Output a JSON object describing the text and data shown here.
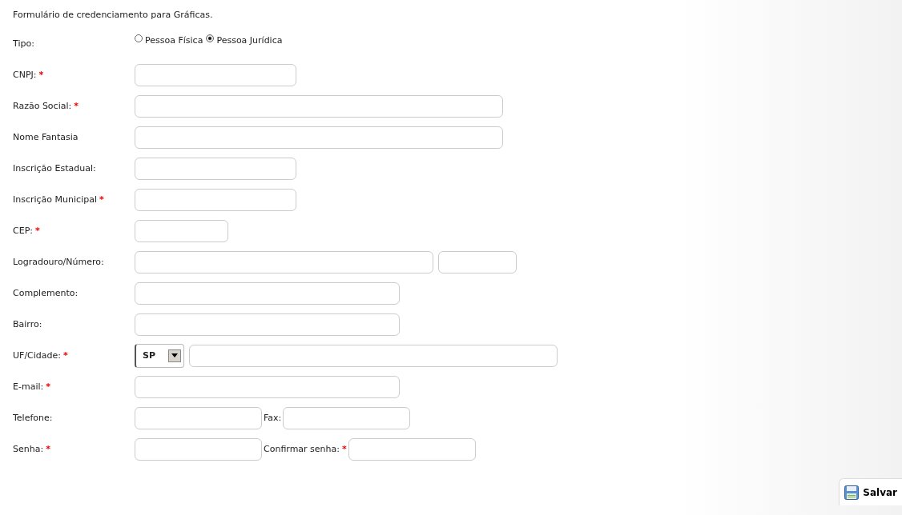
{
  "title": "Formulário de credenciamento para Gráficas.",
  "rows": [
    {
      "label": "Tipo:",
      "kind": "radio",
      "options": [
        {
          "label": "Pessoa Física",
          "selected": false
        },
        {
          "label": "Pessoa Jurídica",
          "selected": true
        }
      ]
    },
    {
      "label": "CNPJ:",
      "required_mark": "*",
      "kind": "fields",
      "fields": [
        {
          "kind": "text"
        }
      ]
    },
    {
      "label": "Razão Social:",
      "required_mark": "*",
      "kind": "fields",
      "fields": [
        {
          "kind": "text"
        }
      ]
    },
    {
      "label": "Nome Fantasia",
      "kind": "fields",
      "fields": [
        {
          "kind": "text"
        }
      ]
    },
    {
      "label": "Inscrição Estadual:",
      "kind": "fields",
      "fields": [
        {
          "kind": "text"
        }
      ]
    },
    {
      "label": "Inscrição Municipal",
      "required_mark": "*",
      "kind": "fields",
      "fields": [
        {
          "kind": "text"
        }
      ]
    },
    {
      "label": "CEP:",
      "required_mark": "*",
      "kind": "fields",
      "fields": [
        {
          "kind": "text"
        }
      ]
    },
    {
      "label": "Logradouro/Número:",
      "kind": "fields",
      "fields": [
        {
          "kind": "text"
        },
        {
          "kind": "text"
        }
      ]
    },
    {
      "label": "Complemento:",
      "kind": "fields",
      "fields": [
        {
          "kind": "text"
        }
      ]
    },
    {
      "label": "Bairro:",
      "kind": "fields",
      "fields": [
        {
          "kind": "text"
        }
      ]
    },
    {
      "label": "UF/Cidade:",
      "required_mark": "*",
      "kind": "fields",
      "fields": [
        {
          "kind": "select",
          "value": "SP"
        },
        {
          "kind": "text"
        }
      ]
    },
    {
      "label": "E-mail:",
      "required_mark": "*",
      "kind": "fields",
      "fields": [
        {
          "kind": "text"
        }
      ]
    },
    {
      "label": "Telefone:",
      "kind": "fields",
      "fields": [
        {
          "kind": "text"
        },
        {
          "kind": "text",
          "label": "Fax:"
        }
      ]
    },
    {
      "label": "Senha:",
      "required_mark": "*",
      "kind": "fields",
      "fields": [
        {
          "kind": "text"
        },
        {
          "kind": "text",
          "label": "Confirmar senha:",
          "required_mark": "*"
        }
      ]
    }
  ],
  "save_button": "Salvar"
}
